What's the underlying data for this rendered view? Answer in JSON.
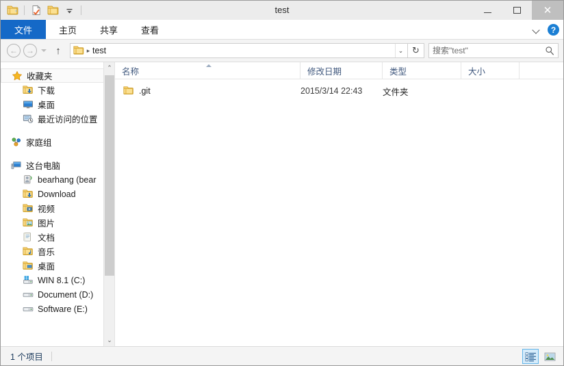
{
  "window": {
    "title": "test",
    "controls": {
      "minimize": "–",
      "maximize": "□",
      "close": "✕"
    }
  },
  "quick_access": {
    "items": [
      {
        "name": "folder-icon",
        "label": ""
      },
      {
        "name": "properties-icon",
        "label": ""
      },
      {
        "name": "new-folder-icon",
        "label": ""
      },
      {
        "name": "customize-chevron-icon",
        "label": ""
      }
    ]
  },
  "ribbon": {
    "tabs": [
      {
        "label": "文件",
        "id": "file",
        "active": true
      },
      {
        "label": "主页",
        "id": "home",
        "active": false
      },
      {
        "label": "共享",
        "id": "share",
        "active": false
      },
      {
        "label": "查看",
        "id": "view",
        "active": false
      }
    ],
    "expand_icon": "chevron-down-icon",
    "help_label": "?"
  },
  "address": {
    "back_glyph": "←",
    "forward_glyph": "→",
    "up_glyph": "↑",
    "separator": "▸",
    "crumb": "test",
    "dropdown_glyph": "⌄",
    "refresh_glyph": "↻"
  },
  "search": {
    "placeholder": "搜索\"test\"",
    "value": ""
  },
  "sidebar": {
    "groups": [
      {
        "root": {
          "label": "收藏夹",
          "icon": "star-icon",
          "selected": true
        },
        "children": [
          {
            "label": "下载",
            "icon": "downloads-folder-icon"
          },
          {
            "label": "桌面",
            "icon": "desktop-monitor-icon"
          },
          {
            "label": "最近访问的位置",
            "icon": "recent-places-icon"
          }
        ]
      },
      {
        "root": {
          "label": "家庭组",
          "icon": "homegroup-icon",
          "selected": false
        },
        "children": []
      },
      {
        "root": {
          "label": "这台电脑",
          "icon": "this-pc-icon",
          "selected": false
        },
        "children": [
          {
            "label": "bearhang (bear",
            "icon": "user-folder-icon"
          },
          {
            "label": "Download",
            "icon": "downloads-folder-icon"
          },
          {
            "label": "视频",
            "icon": "videos-folder-icon"
          },
          {
            "label": "图片",
            "icon": "pictures-folder-icon"
          },
          {
            "label": "文档",
            "icon": "documents-folder-icon"
          },
          {
            "label": "音乐",
            "icon": "music-folder-icon"
          },
          {
            "label": "桌面",
            "icon": "desktop-folder-icon"
          },
          {
            "label": "WIN 8.1 (C:)",
            "icon": "system-drive-icon"
          },
          {
            "label": "Document (D:)",
            "icon": "drive-icon"
          },
          {
            "label": "Software (E:)",
            "icon": "drive-icon"
          }
        ]
      }
    ],
    "scrollbar": {
      "up_glyph": "⌃",
      "down_glyph": "⌄"
    }
  },
  "filelist": {
    "columns": [
      {
        "key": "name",
        "label": "名称",
        "sorted": "asc"
      },
      {
        "key": "date",
        "label": "修改日期",
        "sorted": ""
      },
      {
        "key": "type",
        "label": "类型",
        "sorted": ""
      },
      {
        "key": "size",
        "label": "大小",
        "sorted": ""
      }
    ],
    "rows": [
      {
        "icon": "folder-icon",
        "name": ".git",
        "date": "2015/3/14 22:43",
        "type": "文件夹",
        "size": ""
      }
    ]
  },
  "status": {
    "text": "1 个项目",
    "view_buttons": [
      {
        "name": "details-view-button",
        "active": true
      },
      {
        "name": "large-icons-view-button",
        "active": false
      }
    ]
  },
  "colors": {
    "accent": "#1569c7",
    "help_blue": "#1b7fd4",
    "selected_view": "#d6ecfb",
    "header_text": "#41597e"
  }
}
